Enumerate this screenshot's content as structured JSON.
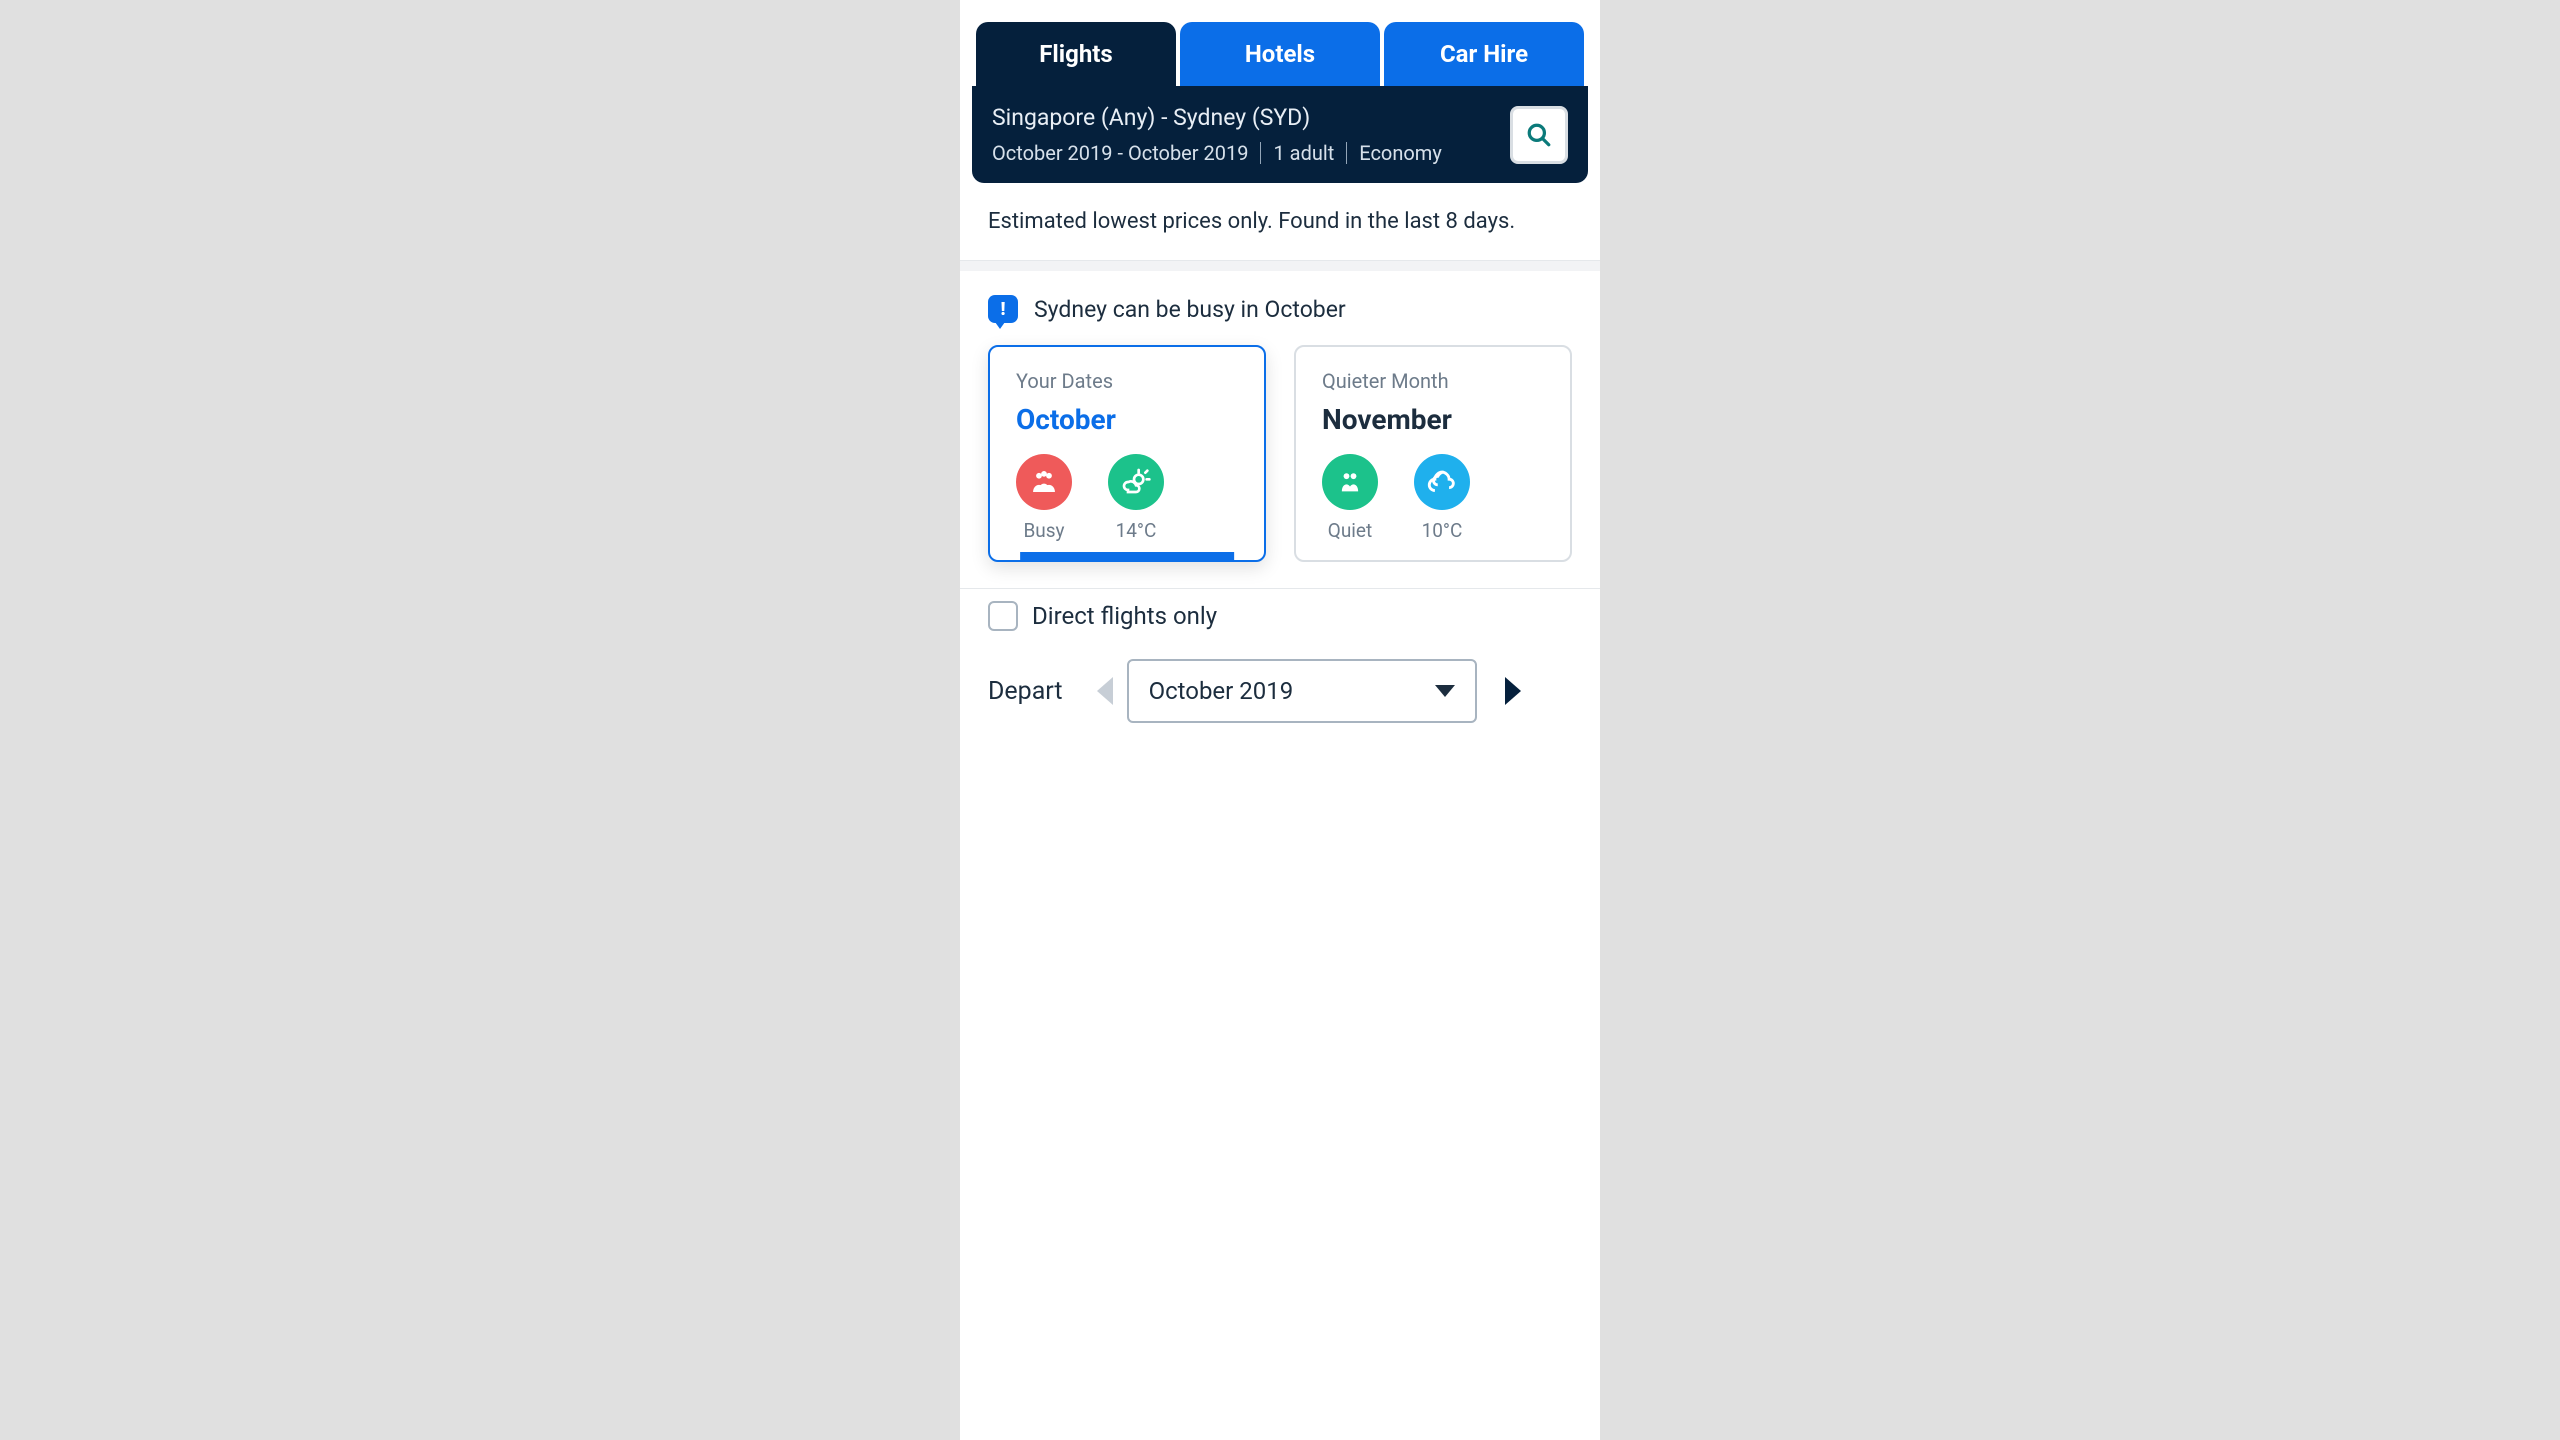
{
  "tabs": {
    "flights": "Flights",
    "hotels": "Hotels",
    "carhire": "Car Hire"
  },
  "summary": {
    "route": "Singapore (Any) - Sydney (SYD)",
    "dates": "October 2019 - October 2019",
    "passengers": "1 adult",
    "cabin": "Economy"
  },
  "disclaimer": "Estimated lowest prices only. Found in the last 8 days.",
  "busy": {
    "headline": "Sydney can be busy in October",
    "card1": {
      "label": "Your Dates",
      "month": "October",
      "crowd": "Busy",
      "temp": "14°C"
    },
    "card2": {
      "label": "Quieter Month",
      "month": "November",
      "crowd": "Quiet",
      "temp": "10°C"
    }
  },
  "filters": {
    "direct_label": "Direct flights only",
    "depart_label": "Depart",
    "depart_value": "October 2019"
  }
}
